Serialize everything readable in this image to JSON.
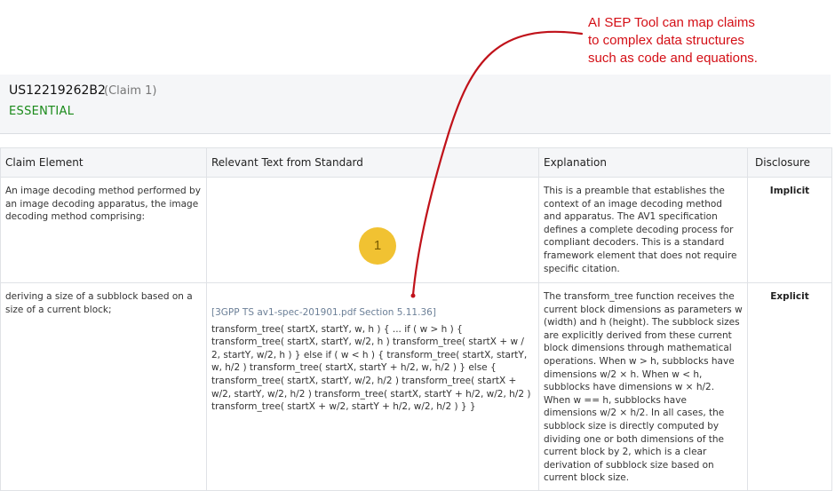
{
  "callout": {
    "lines": [
      "AI SEP Tool can map claims",
      "to complex data structures",
      "such as code and equations."
    ],
    "color": "#d40f16"
  },
  "header": {
    "patent_id": "US12219262B2",
    "claim_ref": "(Claim 1)",
    "status": "ESSENTIAL",
    "status_color": "#1a8a1a"
  },
  "table": {
    "columns": [
      "Claim Element",
      "Relevant Text from Standard",
      "Explanation",
      "Disclosure"
    ],
    "rows": [
      {
        "claim_element": "An image decoding method performed by an image decoding apparatus, the image decoding method comprising:",
        "source_ref": "",
        "relevant_text": "",
        "explanation": "This is a preamble that establishes the context of an image decoding method and apparatus. The AV1 specification defines a complete decoding process for compliant decoders. This is a standard framework element that does not require specific citation.",
        "disclosure": "Implicit"
      },
      {
        "claim_element": "deriving a size of a subblock based on a size of a current block;",
        "source_ref": "[3GPP TS av1-spec-201901.pdf Section 5.11.36]",
        "relevant_text": "transform_tree( startX, startY, w, h ) { ... if ( w > h ) { transform_tree( startX, startY, w/2, h ) transform_tree( startX + w / 2, startY, w/2, h ) } else if ( w < h ) { transform_tree( startX, startY, w, h/2 ) transform_tree( startX, startY + h/2, w, h/2 ) } else { transform_tree( startX, startY, w/2, h/2 ) transform_tree( startX + w/2, startY, w/2, h/2 ) transform_tree( startX, startY + h/2, w/2, h/2 ) transform_tree( startX + w/2, startY + h/2, w/2, h/2 ) } }",
        "explanation": "The transform_tree function receives the current block dimensions as parameters w (width) and h (height). The subblock sizes are explicitly derived from these current block dimensions through mathematical operations. When w > h, subblocks have dimensions w/2 × h. When w < h, subblocks have dimensions w × h/2. When w == h, subblocks have dimensions w/2 × h/2. In all cases, the subblock size is directly computed by dividing one or both dimensions of the current block by 2, which is a clear derivation of subblock size based on current block size.",
        "disclosure": "Explicit"
      }
    ]
  },
  "marker": {
    "label": "1",
    "color": "#f1c232"
  }
}
